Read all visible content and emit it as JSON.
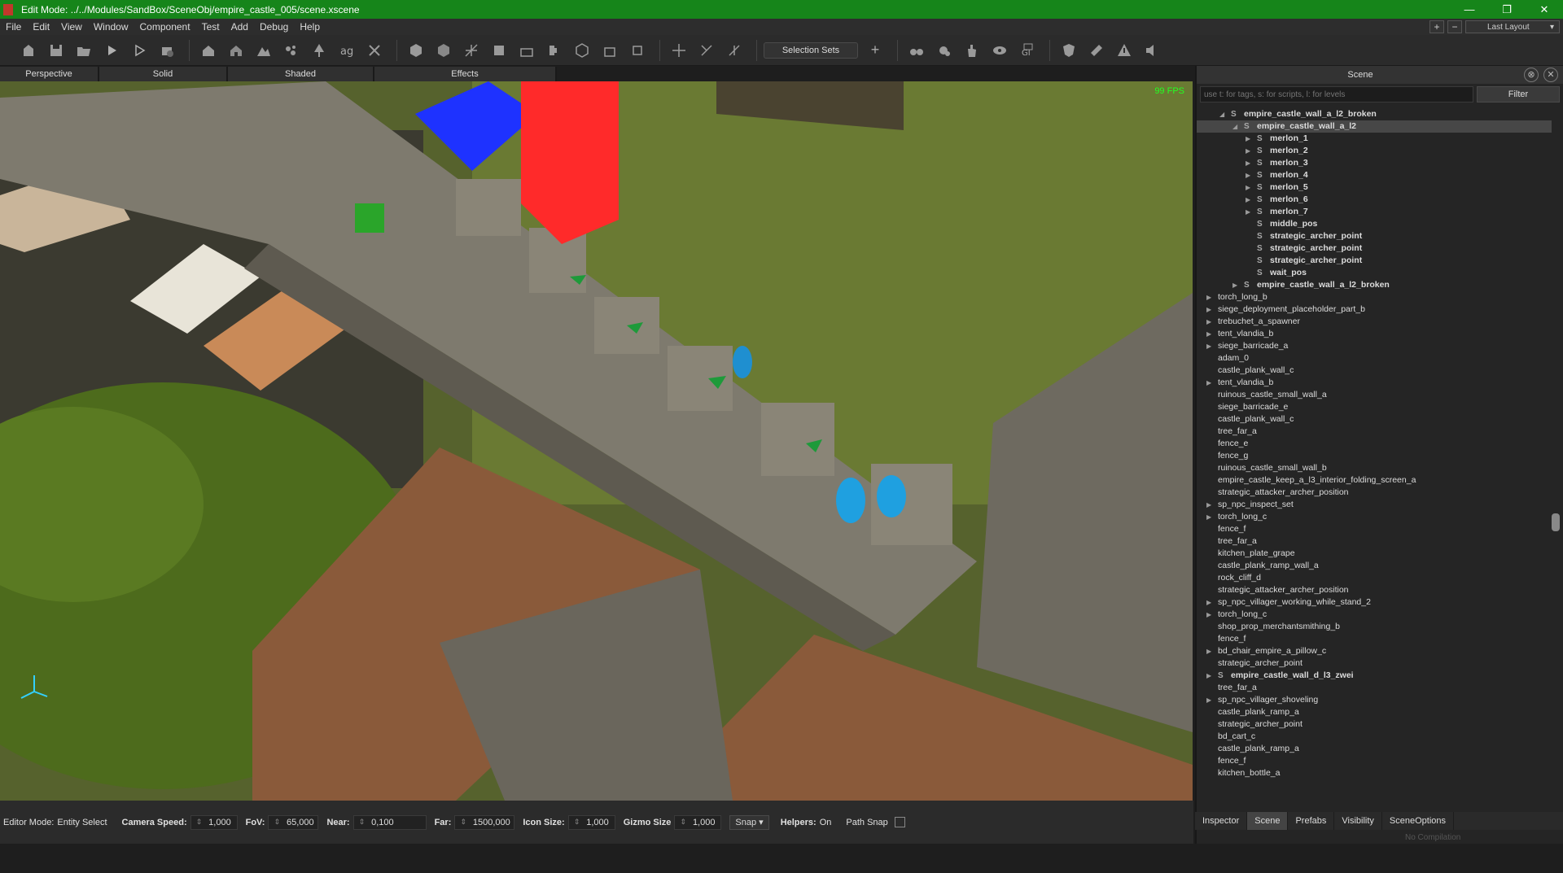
{
  "window": {
    "title": "Edit Mode: ../../Modules/SandBox/SceneObj/empire_castle_005/scene.xscene",
    "minimize": "—",
    "maximize": "❐",
    "close": "✕"
  },
  "menu": [
    "File",
    "Edit",
    "View",
    "Window",
    "Component",
    "Test",
    "Add",
    "Debug",
    "Help"
  ],
  "layout": {
    "plus": "+",
    "minus": "−",
    "label": "Last Layout"
  },
  "toolbar": {
    "selection_sets": "Selection Sets",
    "add": "+"
  },
  "view_tabs": [
    "Perspective",
    "Solid",
    "Shaded",
    "Effects"
  ],
  "viewport": {
    "fps": "99 FPS"
  },
  "status": {
    "editor_mode_label": "Editor Mode:",
    "editor_mode_value": "Entity Select",
    "camera_speed_label": "Camera Speed:",
    "camera_speed": "1,000",
    "fov_label": "FoV:",
    "fov": "65,000",
    "near_label": "Near:",
    "near": "0,100",
    "far_label": "Far:",
    "far": "1500,000",
    "icon_size_label": "Icon Size:",
    "icon_size": "1,000",
    "gizmo_size_label": "Gizmo Size",
    "gizmo_size": "1,000",
    "snap": "Snap",
    "helpers_label": "Helpers:",
    "helpers_value": "On",
    "path_snap": "Path Snap"
  },
  "scene_panel": {
    "title": "Scene",
    "search_placeholder": "use t: for tags, s: for scripts, l: for levels",
    "filter": "Filter",
    "tree": [
      {
        "label": "empire_castle_wall_a_l2_broken",
        "expand": "open",
        "icon": true,
        "bold": true
      },
      {
        "label": "empire_castle_wall_a_l2",
        "expand": "open",
        "icon": true,
        "bold": true,
        "selected": true
      },
      {
        "label": "merlon_1",
        "expand": "closed",
        "icon": true,
        "bold": true
      },
      {
        "label": "merlon_2",
        "expand": "closed",
        "icon": true,
        "bold": true
      },
      {
        "label": "merlon_3",
        "expand": "closed",
        "icon": true,
        "bold": true
      },
      {
        "label": "merlon_4",
        "expand": "closed",
        "icon": true,
        "bold": true
      },
      {
        "label": "merlon_5",
        "expand": "closed",
        "icon": true,
        "bold": true
      },
      {
        "label": "merlon_6",
        "expand": "closed",
        "icon": true,
        "bold": true
      },
      {
        "label": "merlon_7",
        "expand": "closed",
        "icon": true,
        "bold": true
      },
      {
        "label": "middle_pos",
        "expand": "none",
        "icon": true,
        "bold": true
      },
      {
        "label": "strategic_archer_point",
        "expand": "none",
        "icon": true,
        "bold": true
      },
      {
        "label": "strategic_archer_point",
        "expand": "none",
        "icon": true,
        "bold": true
      },
      {
        "label": "strategic_archer_point",
        "expand": "none",
        "icon": true,
        "bold": true
      },
      {
        "label": "wait_pos",
        "expand": "none",
        "icon": true,
        "bold": true
      },
      {
        "label": "empire_castle_wall_a_l2_broken",
        "expand": "closed",
        "icon": true,
        "bold": true
      },
      {
        "label": "torch_long_b",
        "expand": "closed",
        "icon": false,
        "bold": false
      },
      {
        "label": "siege_deployment_placeholder_part_b",
        "expand": "closed",
        "icon": false,
        "bold": false
      },
      {
        "label": "trebuchet_a_spawner",
        "expand": "closed",
        "icon": false,
        "bold": false
      },
      {
        "label": "tent_vlandia_b",
        "expand": "closed",
        "icon": false,
        "bold": false
      },
      {
        "label": "siege_barricade_a",
        "expand": "closed",
        "icon": false,
        "bold": false
      },
      {
        "label": "adam_0",
        "expand": "none",
        "icon": false,
        "bold": false
      },
      {
        "label": "castle_plank_wall_c",
        "expand": "none",
        "icon": false,
        "bold": false
      },
      {
        "label": "tent_vlandia_b",
        "expand": "closed",
        "icon": false,
        "bold": false
      },
      {
        "label": "ruinous_castle_small_wall_a",
        "expand": "none",
        "icon": false,
        "bold": false
      },
      {
        "label": "siege_barricade_e",
        "expand": "none",
        "icon": false,
        "bold": false
      },
      {
        "label": "castle_plank_wall_c",
        "expand": "none",
        "icon": false,
        "bold": false
      },
      {
        "label": "tree_far_a",
        "expand": "none",
        "icon": false,
        "bold": false
      },
      {
        "label": "fence_e",
        "expand": "none",
        "icon": false,
        "bold": false
      },
      {
        "label": "fence_g",
        "expand": "none",
        "icon": false,
        "bold": false
      },
      {
        "label": "ruinous_castle_small_wall_b",
        "expand": "none",
        "icon": false,
        "bold": false
      },
      {
        "label": "empire_castle_keep_a_l3_interior_folding_screen_a",
        "expand": "none",
        "icon": false,
        "bold": false
      },
      {
        "label": "strategic_attacker_archer_position",
        "expand": "none",
        "icon": false,
        "bold": false
      },
      {
        "label": "sp_npc_inspect_set",
        "expand": "closed",
        "icon": false,
        "bold": false
      },
      {
        "label": "torch_long_c",
        "expand": "closed",
        "icon": false,
        "bold": false
      },
      {
        "label": "fence_f",
        "expand": "none",
        "icon": false,
        "bold": false
      },
      {
        "label": "tree_far_a",
        "expand": "none",
        "icon": false,
        "bold": false
      },
      {
        "label": "kitchen_plate_grape",
        "expand": "none",
        "icon": false,
        "bold": false
      },
      {
        "label": "castle_plank_ramp_wall_a",
        "expand": "none",
        "icon": false,
        "bold": false
      },
      {
        "label": "rock_cliff_d",
        "expand": "none",
        "icon": false,
        "bold": false
      },
      {
        "label": "strategic_attacker_archer_position",
        "expand": "none",
        "icon": false,
        "bold": false
      },
      {
        "label": "sp_npc_villager_working_while_stand_2",
        "expand": "closed",
        "icon": false,
        "bold": false
      },
      {
        "label": "torch_long_c",
        "expand": "closed",
        "icon": false,
        "bold": false
      },
      {
        "label": "shop_prop_merchantsmithing_b",
        "expand": "none",
        "icon": false,
        "bold": false
      },
      {
        "label": "fence_f",
        "expand": "none",
        "icon": false,
        "bold": false
      },
      {
        "label": "bd_chair_empire_a_pillow_c",
        "expand": "closed",
        "icon": false,
        "bold": false
      },
      {
        "label": "strategic_archer_point",
        "expand": "none",
        "icon": false,
        "bold": false
      },
      {
        "label": "empire_castle_wall_d_l3_zwei",
        "expand": "closed",
        "icon": true,
        "bold": true
      },
      {
        "label": "tree_far_a",
        "expand": "none",
        "icon": false,
        "bold": false
      },
      {
        "label": "sp_npc_villager_shoveling",
        "expand": "closed",
        "icon": false,
        "bold": false
      },
      {
        "label": "castle_plank_ramp_a",
        "expand": "none",
        "icon": false,
        "bold": false
      },
      {
        "label": "strategic_archer_point",
        "expand": "none",
        "icon": false,
        "bold": false
      },
      {
        "label": "bd_cart_c",
        "expand": "none",
        "icon": false,
        "bold": false
      },
      {
        "label": "castle_plank_ramp_a",
        "expand": "none",
        "icon": false,
        "bold": false
      },
      {
        "label": "fence_f",
        "expand": "none",
        "icon": false,
        "bold": false
      },
      {
        "label": "kitchen_bottle_a",
        "expand": "none",
        "icon": false,
        "bold": false
      }
    ],
    "tabs": [
      "Inspector",
      "Scene",
      "Prefabs",
      "Visibility",
      "SceneOptions"
    ],
    "active_tab": "Scene",
    "footer": "No Compilation"
  },
  "colors": {
    "titlebar": "#16851a",
    "selection": "#474747",
    "fps": "#23ff23"
  }
}
